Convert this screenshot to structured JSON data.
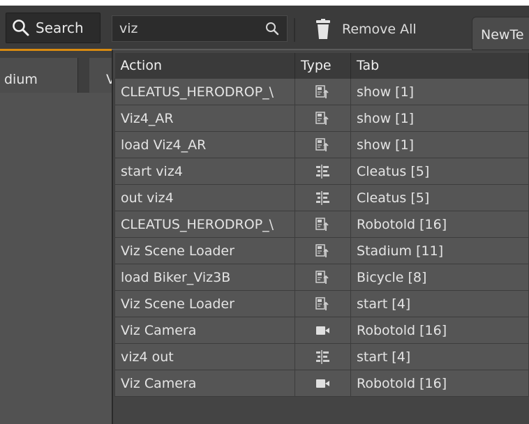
{
  "toolbar": {
    "search_label": "Search",
    "filter_value": "viz",
    "remove_all_label": "Remove All",
    "new_tab_label": "NewTe"
  },
  "left_tabs": {
    "stadium_label": "dium",
    "v_label": "V"
  },
  "table": {
    "headers": {
      "action": "Action",
      "type": "Type",
      "tab": "Tab"
    },
    "rows": [
      {
        "action": "CLEATUS_HERODROP_\\",
        "type_icon": "scene-loader-icon",
        "tab": "show [1]"
      },
      {
        "action": "Viz4_AR",
        "type_icon": "scene-loader-icon",
        "tab": "show [1]"
      },
      {
        "action": "load Viz4_AR",
        "type_icon": "scene-loader-icon",
        "tab": "show [1]"
      },
      {
        "action": "start viz4",
        "type_icon": "timeline-icon",
        "tab": "Cleatus [5]"
      },
      {
        "action": "out viz4",
        "type_icon": "timeline-icon",
        "tab": "Cleatus [5]"
      },
      {
        "action": "CLEATUS_HERODROP_\\",
        "type_icon": "scene-loader-icon",
        "tab": "Robotold [16]"
      },
      {
        "action": "Viz Scene Loader",
        "type_icon": "scene-loader-icon",
        "tab": "Stadium [11]"
      },
      {
        "action": "load Biker_Viz3B",
        "type_icon": "scene-loader-icon",
        "tab": "Bicycle [8]"
      },
      {
        "action": "Viz Scene Loader",
        "type_icon": "scene-loader-icon",
        "tab": "start [4]"
      },
      {
        "action": "Viz Camera",
        "type_icon": "camera-icon",
        "tab": "Robotold [16]"
      },
      {
        "action": "viz4 out",
        "type_icon": "timeline-icon",
        "tab": "start [4]"
      },
      {
        "action": "Viz Camera",
        "type_icon": "camera-icon",
        "tab": "Robotold [16]"
      }
    ]
  },
  "colors": {
    "accent_orange": "#d88a10",
    "row_bg": "#555555",
    "panel_bg": "#444444"
  }
}
